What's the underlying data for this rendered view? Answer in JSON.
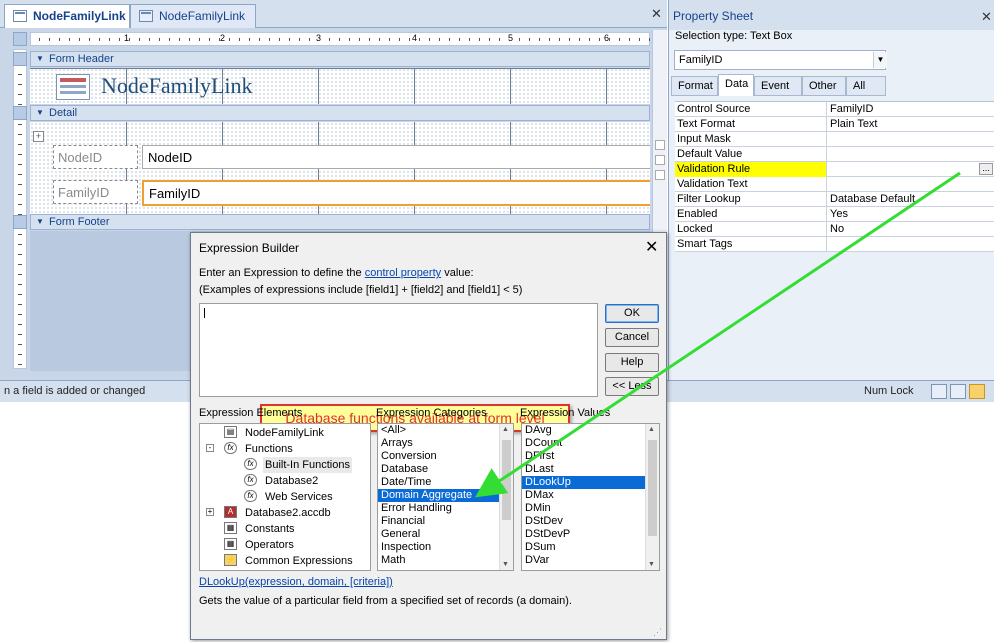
{
  "design_tabs": [
    {
      "label": "NodeFamilyLink",
      "active": true
    },
    {
      "label": "NodeFamilyLink",
      "active": false
    }
  ],
  "ruler_numbers": [
    "1",
    "2",
    "3",
    "4",
    "5",
    "6"
  ],
  "sections": {
    "header": "Form Header",
    "detail": "Detail",
    "footer": "Form Footer"
  },
  "form_title": "NodeFamilyLink",
  "controls": {
    "node_label": "NodeID",
    "node_box": "NodeID",
    "family_label": "FamilyID",
    "family_box": "FamilyID"
  },
  "status": {
    "text": "n a field is added or changed",
    "num_lock": "Num Lock"
  },
  "property_sheet": {
    "title": "Property Sheet",
    "selection_type": "Selection type:  Text Box",
    "selected_control": "FamilyID",
    "tabs": [
      {
        "label": "Format",
        "selected": false
      },
      {
        "label": "Data",
        "selected": true
      },
      {
        "label": "Event",
        "selected": false
      },
      {
        "label": "Other",
        "selected": false
      },
      {
        "label": "All",
        "selected": false
      }
    ],
    "rows": [
      {
        "name": "Control Source",
        "value": "FamilyID"
      },
      {
        "name": "Text Format",
        "value": "Plain Text"
      },
      {
        "name": "Input Mask",
        "value": ""
      },
      {
        "name": "Default Value",
        "value": ""
      },
      {
        "name": "Validation Rule",
        "value": "",
        "highlight": true
      },
      {
        "name": "Validation Text",
        "value": ""
      },
      {
        "name": "Filter Lookup",
        "value": "Database Default"
      },
      {
        "name": "Enabled",
        "value": "Yes"
      },
      {
        "name": "Locked",
        "value": "No"
      },
      {
        "name": "Smart Tags",
        "value": ""
      }
    ],
    "ellipsis": "..."
  },
  "expression_builder": {
    "title": "Expression Builder",
    "intro_prefix": "Enter an Expression to define the ",
    "intro_link": "control property",
    "intro_suffix": " value:",
    "examples": "(Examples of expressions include [field1] + [field2] and [field1] < 5)",
    "callout": "Database functions available at form level",
    "buttons": {
      "ok": "OK",
      "cancel": "Cancel",
      "help": "Help",
      "less": "<< Less"
    },
    "elements_header": "Expression Elements",
    "categories_header": "Expression Categories",
    "values_header": "Expression Values",
    "elements": [
      {
        "label": "NodeFamilyLink",
        "icon": "form-icon",
        "indent": 1,
        "toggle": ""
      },
      {
        "label": "Functions",
        "icon": "function-icon",
        "indent": 1,
        "toggle": "-"
      },
      {
        "label": "Built-In Functions",
        "icon": "function-icon",
        "indent": 2,
        "toggle": "",
        "selected": true
      },
      {
        "label": "Database2",
        "icon": "function-icon",
        "indent": 2,
        "toggle": ""
      },
      {
        "label": "Web Services",
        "icon": "function-icon",
        "indent": 2,
        "toggle": ""
      },
      {
        "label": "Database2.accdb",
        "icon": "access-db-icon",
        "indent": 1,
        "toggle": "+"
      },
      {
        "label": "Constants",
        "icon": "constants-icon",
        "indent": 1,
        "toggle": ""
      },
      {
        "label": "Operators",
        "icon": "operators-icon",
        "indent": 1,
        "toggle": ""
      },
      {
        "label": "Common Expressions",
        "icon": "common-expressions-icon",
        "indent": 1,
        "toggle": ""
      }
    ],
    "categories": [
      "<All>",
      "Arrays",
      "Conversion",
      "Database",
      "Date/Time",
      "Domain Aggregate",
      "Error Handling",
      "Financial",
      "General",
      "Inspection",
      "Math"
    ],
    "selected_category": "Domain Aggregate",
    "values": [
      "DAvg",
      "DCount",
      "DFirst",
      "DLast",
      "DLookUp",
      "DMax",
      "DMin",
      "DStDev",
      "DStDevP",
      "DSum",
      "DVar"
    ],
    "selected_value": "DLookUp",
    "syntax": "DLookUp(expression, domain, [criteria])",
    "description": "Gets the value of a particular field from a specified set of records (a domain)."
  },
  "colors": {
    "highlight": "#ffff00",
    "selection": "#0a6ad6",
    "arrow": "#33dd33",
    "callout_border": "#dd3333",
    "accent": "#15428b"
  }
}
